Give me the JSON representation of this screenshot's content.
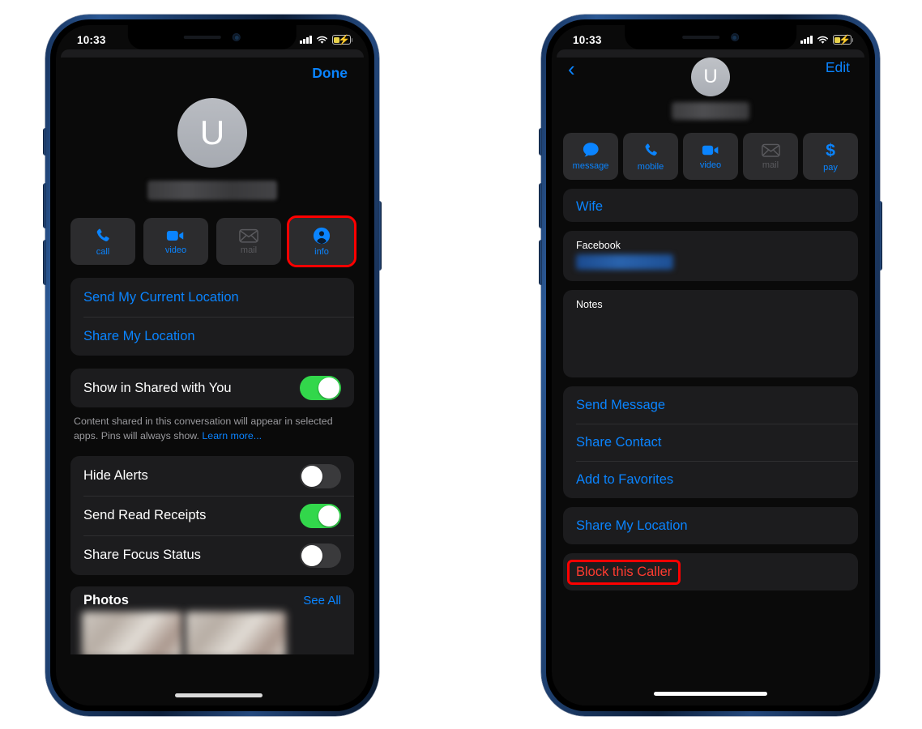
{
  "status_bar": {
    "time": "10:33",
    "icons": [
      "signal-bars-icon",
      "wifi-icon",
      "battery-charging-icon"
    ]
  },
  "colors": {
    "accent_blue": "#0a84ff",
    "toggle_on_green": "#32d74b",
    "highlight_red": "#ff0000",
    "destructive_red": "#ff3b30",
    "card_bg": "#1c1c1e",
    "button_bg": "#2c2c2e",
    "screen_bg": "#0a0a0a",
    "phone_frame": "#1b3a66"
  },
  "left_phone": {
    "name": "messages-conversation-details",
    "nav": {
      "done_label": "Done"
    },
    "avatar": {
      "initial": "U",
      "name_redacted": true
    },
    "actions": [
      {
        "label": "call",
        "icon": "phone-icon",
        "enabled": true,
        "highlighted": false
      },
      {
        "label": "video",
        "icon": "video-camera-icon",
        "enabled": true,
        "highlighted": false
      },
      {
        "label": "mail",
        "icon": "envelope-icon",
        "enabled": false,
        "highlighted": false
      },
      {
        "label": "info",
        "icon": "person-circle-icon",
        "enabled": true,
        "highlighted": true
      }
    ],
    "location_group": [
      {
        "label": "Send My Current Location"
      },
      {
        "label": "Share My Location"
      }
    ],
    "shared_with_you": {
      "label": "Show in Shared with You",
      "state": "on",
      "footnote_text": "Content shared in this conversation will appear in selected apps. Pins will always show. ",
      "footnote_link": "Learn more..."
    },
    "toggles": [
      {
        "label": "Hide Alerts",
        "state": "off"
      },
      {
        "label": "Send Read Receipts",
        "state": "on"
      },
      {
        "label": "Share Focus Status",
        "state": "off"
      }
    ],
    "photos": {
      "title": "Photos",
      "see_all_label": "See All"
    }
  },
  "right_phone": {
    "name": "contact-card-detail",
    "nav": {
      "back_icon": "chevron-left-icon",
      "edit_label": "Edit"
    },
    "avatar": {
      "initial": "U",
      "name_redacted": true
    },
    "actions": [
      {
        "label": "message",
        "icon": "message-bubble-icon",
        "enabled": true
      },
      {
        "label": "mobile",
        "icon": "phone-icon",
        "enabled": true
      },
      {
        "label": "video",
        "icon": "video-camera-icon",
        "enabled": true
      },
      {
        "label": "mail",
        "icon": "envelope-icon",
        "enabled": false
      },
      {
        "label": "pay",
        "icon": "dollar-sign-icon",
        "enabled": true
      }
    ],
    "phone_field": {
      "label": "",
      "value": "Wife"
    },
    "facebook_field": {
      "label": "Facebook",
      "value_redacted": true
    },
    "notes_field": {
      "label": "Notes",
      "value": ""
    },
    "actions_group": [
      {
        "label": "Send Message",
        "destructive": false
      },
      {
        "label": "Share Contact",
        "destructive": false
      },
      {
        "label": "Add to Favorites",
        "destructive": false
      }
    ],
    "location_group": [
      {
        "label": "Share My Location",
        "destructive": false
      }
    ],
    "block_group": [
      {
        "label": "Block this Caller",
        "destructive": true,
        "highlighted": true
      }
    ]
  }
}
